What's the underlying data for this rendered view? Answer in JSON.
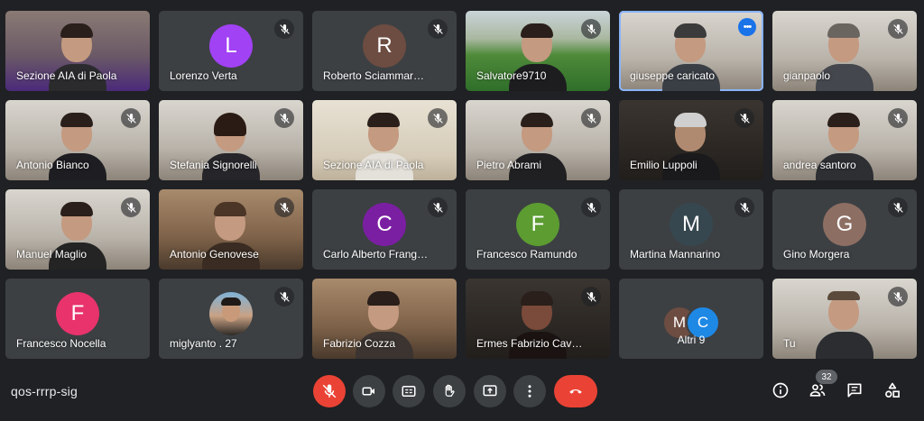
{
  "participants": [
    {
      "name": "Sezione AIA di Paola"
    },
    {
      "name": "Lorenzo Verta",
      "initial": "L",
      "color": "#a142f4"
    },
    {
      "name": "Roberto Sciammarella",
      "initial": "R",
      "color": "#6d4c41"
    },
    {
      "name": "Salvatore9710"
    },
    {
      "name": "giuseppe caricato",
      "more": "•••"
    },
    {
      "name": "gianpaolo"
    },
    {
      "name": "Antonio Bianco"
    },
    {
      "name": "Stefania Signorelli"
    },
    {
      "name": "Sezione AIA di Paola"
    },
    {
      "name": "Pietro Abrami"
    },
    {
      "name": "Emilio Luppoli"
    },
    {
      "name": "andrea santoro"
    },
    {
      "name": "Manuel Maglio"
    },
    {
      "name": "Antonio Genovese"
    },
    {
      "name": "Carlo Alberto Frangella",
      "initial": "C",
      "color": "#7b1fa2"
    },
    {
      "name": "Francesco Ramundo",
      "initial": "F",
      "color": "#5c9c31"
    },
    {
      "name": "Martina Mannarino",
      "initial": "M",
      "color": "#37474f"
    },
    {
      "name": "Gino Morgera",
      "initial": "G",
      "color": "#8d6e63"
    },
    {
      "name": "Francesco Nocella",
      "initial": "F",
      "color": "#e8336d"
    },
    {
      "name": "miglyanto . 27"
    },
    {
      "name": "Fabrizio Cozza"
    },
    {
      "name": "Ermes Fabrizio Cavali..."
    },
    {
      "name": "Altri 9",
      "mini": [
        {
          "initial": "M",
          "color": "#6d4c41"
        },
        {
          "initial": "C",
          "color": "#1e88e5"
        }
      ]
    },
    {
      "name": "Tu"
    }
  ],
  "meeting_code": "qos-rrrp-sig",
  "participants_count": "32",
  "colors": {
    "background": "#202124",
    "tile": "#3c4043",
    "end_call": "#ea4335",
    "accent": "#8ab4f8"
  },
  "icons": {
    "muted": "mic-off-icon",
    "more": "more-options-icon",
    "mic": "mic-off-icon",
    "camera": "camera-icon",
    "captions": "captions-icon",
    "hand": "raise-hand-icon",
    "present": "present-screen-icon",
    "more_vert": "more-vert-icon",
    "end": "end-call-icon",
    "info": "info-icon",
    "people": "people-icon",
    "chat": "chat-icon",
    "activities": "activities-icon"
  }
}
